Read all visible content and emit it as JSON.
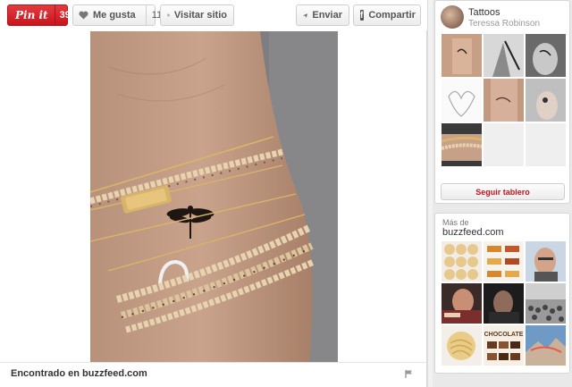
{
  "toolbar": {
    "pinit_label": "Pin it",
    "pinit_count": "39",
    "like_label": "Me gusta",
    "like_count": "11",
    "visit_label": "Visitar sitio",
    "send_label": "Enviar",
    "share_label": "Compartir"
  },
  "footer": {
    "found_on": "Encontrado en buzzfeed.com"
  },
  "board": {
    "title": "Tattoos",
    "owner": "Teressa Robinson",
    "follow_label": "Seguir tablero"
  },
  "more": {
    "label": "Más de",
    "source": "buzzfeed.com",
    "chocolate_label": "CHOCOLATE"
  },
  "colors": {
    "pin_red": "#c9141c",
    "page_bg": "#e9e9e9"
  }
}
